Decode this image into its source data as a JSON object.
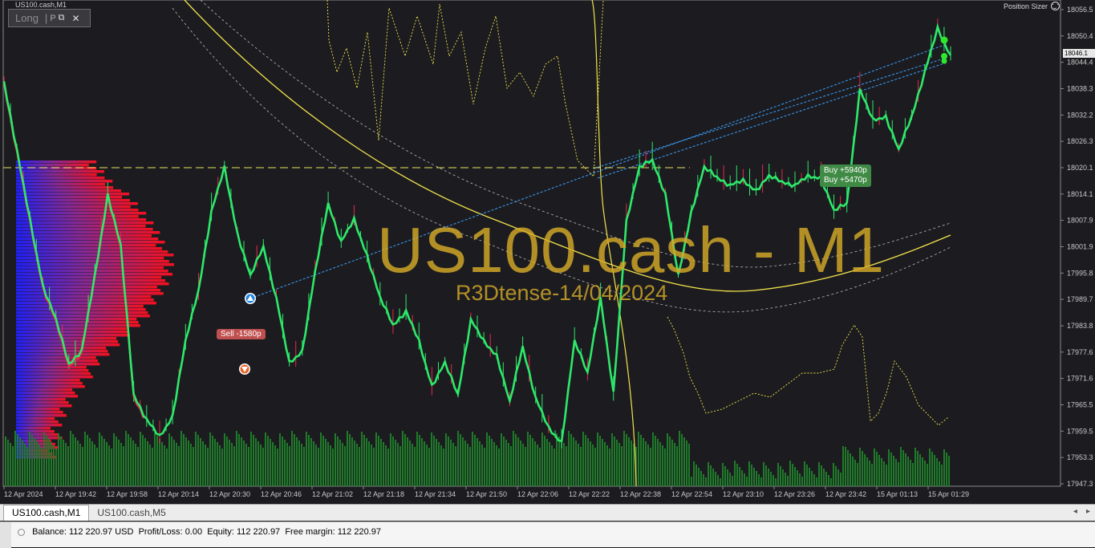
{
  "window": {
    "title": "US100.cash,M1"
  },
  "trade_panel": {
    "direction": "Long",
    "mode": "P",
    "restore_glyph": "⧉",
    "close_glyph": "✕",
    "separator": "|"
  },
  "position_sizer": {
    "label": "Position Sizer",
    "icon": "smiley-icon"
  },
  "current_price": "18046.1",
  "watermark": {
    "title": "US100.cash - M1",
    "subtitle": "R3Dtense-14/04/2024"
  },
  "trade_labels": {
    "sell": "Sell -1580p",
    "buy1": "Buy +5940p",
    "buy2": "Buy +5470p"
  },
  "chart_data": {
    "type": "line",
    "symbol": "US100.cash",
    "timeframe": "M1",
    "y_ticks": [
      "18056.5",
      "18050.4",
      "18044.4",
      "18038.3",
      "18032.2",
      "18026.3",
      "18020.1",
      "18014.1",
      "18007.9",
      "18001.9",
      "17995.8",
      "17989.7",
      "17983.8",
      "17977.6",
      "17971.6",
      "17965.5",
      "17959.5",
      "17953.3",
      "17947.3"
    ],
    "x_ticks": [
      "12 Apr 2024",
      "12 Apr 19:42",
      "12 Apr 19:58",
      "12 Apr 20:14",
      "12 Apr 20:30",
      "12 Apr 20:46",
      "12 Apr 21:02",
      "12 Apr 21:18",
      "12 Apr 21:34",
      "12 Apr 21:50",
      "12 Apr 22:06",
      "12 Apr 22:22",
      "12 Apr 22:38",
      "12 Apr 22:54",
      "12 Apr 23:10",
      "12 Apr 23:26",
      "12 Apr 23:42",
      "15 Apr 01:13",
      "15 Apr 01:29"
    ],
    "ylim": [
      17947.3,
      18056.5
    ],
    "horizontal_line": 18020.1,
    "price_series": [
      18040.0,
      18024.0,
      18008.0,
      17993.0,
      17985.0,
      17975.0,
      17978.0,
      17995.0,
      18014.0,
      18002.0,
      17968.0,
      17962.0,
      17958.0,
      17963.0,
      17980.0,
      17992.0,
      18010.0,
      18020.0,
      18005.0,
      17995.0,
      18002.0,
      17990.0,
      17975.0,
      17978.0,
      17996.0,
      18012.0,
      18003.0,
      18008.0,
      18000.0,
      17990.0,
      17984.0,
      17987.0,
      17980.0,
      17970.0,
      17975.0,
      17968.0,
      17985.0,
      17980.0,
      17977.0,
      17966.0,
      17979.0,
      17967.0,
      17960.0,
      17957.0,
      17980.0,
      17973.0,
      17990.0,
      17968.0,
      18008.0,
      18020.0,
      18022.0,
      18014.0,
      17995.0,
      18010.0,
      18020.0,
      18018.0,
      18016.0,
      18017.0,
      18015.0,
      18018.0,
      18017.0,
      18016.0,
      18018.0,
      18018.0,
      18010.0,
      18012.0,
      18038.0,
      18031.0,
      18032.0,
      18024.0,
      18032.0,
      18042.0,
      18052.0,
      18046.0
    ],
    "sell_arrow_price": 17975.0,
    "buy_arrow_price": 17989.7
  },
  "tabs": [
    {
      "label": "US100.cash,M1",
      "active": true
    },
    {
      "label": "US100.cash,M5",
      "active": false
    }
  ],
  "tab_nav": {
    "left": "◂",
    "right": "▸"
  },
  "account": {
    "balance_label": "Balance:",
    "balance": "112 220.97 USD",
    "pl_label": "Profit/Loss:",
    "pl": "0.00",
    "equity_label": "Equity:",
    "equity": "112 220.97",
    "free_margin_label": "Free margin:",
    "free_margin": "112 220.97"
  },
  "colors": {
    "background": "#1c1c20",
    "price_line": "#2ee86a",
    "price_shadow": "#e8284a",
    "ma": "#f2e24a",
    "trendline": "#3aa0ff",
    "volume": "#1f7a2a",
    "profile_blue": "#2a2aff",
    "profile_red": "#ff1020",
    "watermark": "#d4aa28"
  }
}
